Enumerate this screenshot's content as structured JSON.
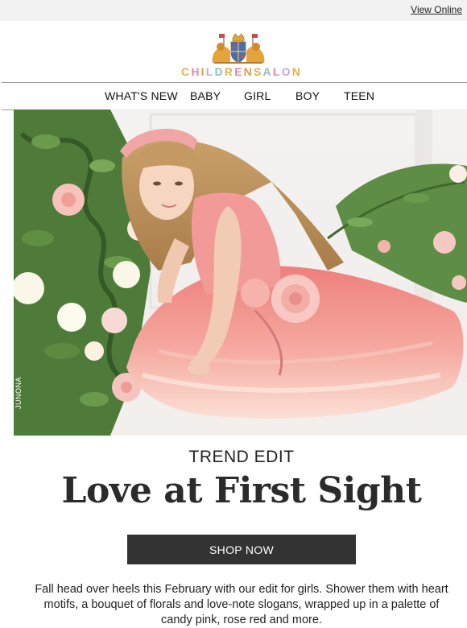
{
  "header": {
    "view_online": "View Online"
  },
  "logo": {
    "letters": [
      "C",
      "H",
      "I",
      "L",
      "D",
      "R",
      "E",
      "N",
      "S",
      "A",
      "L",
      "O",
      "N"
    ],
    "letter_colors": [
      "#e8b04a",
      "#e88a9c",
      "#d9a34b",
      "#c9a7d8",
      "#8bc3b8",
      "#e8b04a",
      "#e88a9c",
      "#d9a34b",
      "#e8b04a",
      "#8bc3b8",
      "#e88a9c",
      "#c9a7d8",
      "#e8b04a"
    ],
    "icon": "royal-crest-icon"
  },
  "nav": {
    "items": [
      {
        "label": "WHAT'S NEW"
      },
      {
        "label": "BABY"
      },
      {
        "label": "GIRL"
      },
      {
        "label": "BOY"
      },
      {
        "label": "TEEN"
      }
    ]
  },
  "hero": {
    "credit": "JUNONA",
    "dress_color": "#f08a86",
    "flower_color": "#f7c9c4"
  },
  "content": {
    "eyebrow": "TREND EDIT",
    "headline": "Love at First Sight",
    "cta": "SHOP NOW",
    "body": "Fall head over heels this February with our edit for girls. Shower them with heart motifs, a bouquet of florals and love-note slogans, wrapped up in a palette of candy pink, rose red and more."
  }
}
